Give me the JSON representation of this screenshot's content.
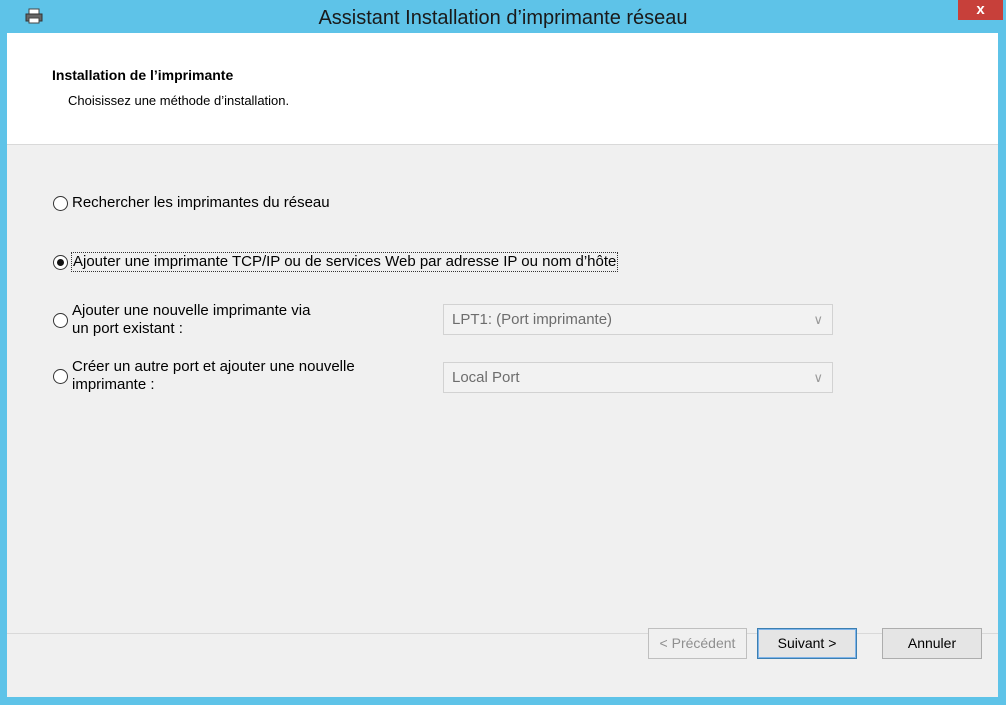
{
  "window": {
    "title": "Assistant Installation d’imprimante réseau",
    "close_label": "x",
    "app_icon": "printer-icon"
  },
  "header": {
    "title": "Installation de l’imprimante",
    "subtitle": "Choisissez une méthode d’installation."
  },
  "options": [
    {
      "label": "Rechercher les imprimantes du réseau",
      "selected": false
    },
    {
      "label": "Ajouter une imprimante TCP/IP ou de services Web par adresse IP ou nom d’hôte",
      "selected": true
    },
    {
      "label_line1": "Ajouter une nouvelle imprimante via",
      "label_line2": "un port existant :",
      "selected": false
    },
    {
      "label_line1": "Créer un autre port et ajouter une nouvelle",
      "label_line2": "imprimante :",
      "selected": false
    }
  ],
  "combos": {
    "existing_port": {
      "value": "LPT1: (Port imprimante)"
    },
    "new_port": {
      "value": "Local Port"
    }
  },
  "buttons": {
    "previous": "< Précédent",
    "next": "Suivant >",
    "cancel": "Annuler"
  },
  "colors": {
    "title_bar": "#5ec3e8",
    "close_button": "#c7403a",
    "client_bg": "#f0f0f0"
  }
}
